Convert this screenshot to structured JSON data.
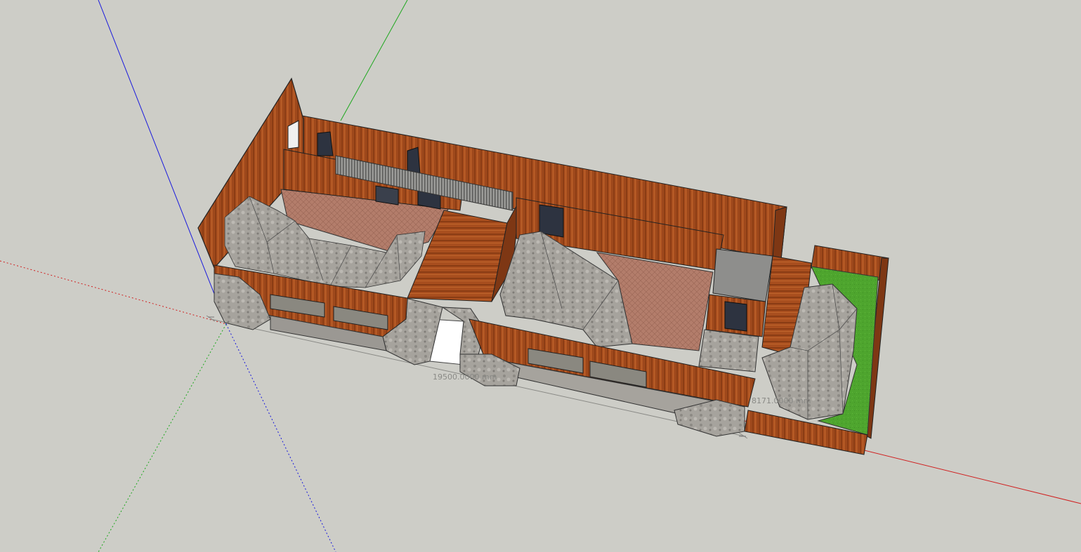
{
  "viewport": {
    "background": "#cdcdc7",
    "wood_color": "#a9501f",
    "wood_dark": "#7e3714",
    "stone_color": "#a3a19b",
    "stone_dark": "#6c6a66",
    "floor_tile": "#b07a68",
    "grass_color": "#4fa52f",
    "window_color": "#2d3340"
  },
  "axes": {
    "red_axis": "red-axis",
    "green_axis": "green-axis",
    "blue_axis": "blue-axis"
  },
  "dimensions": {
    "length_label": "19500.0000 mm",
    "width_label": "8171.0000 mm"
  }
}
